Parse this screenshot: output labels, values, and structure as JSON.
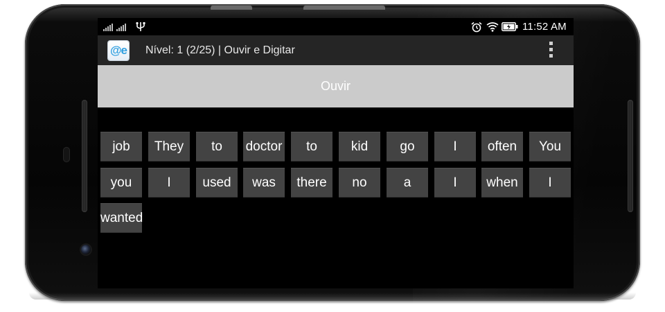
{
  "status_bar": {
    "time": "11:52 AM",
    "icons": [
      "signal-icon",
      "usb-icon",
      "alarm-icon",
      "wifi-icon",
      "battery-icon"
    ]
  },
  "action_bar": {
    "app_icon_text": "@e",
    "title": "Nível: 1 (2/25) | Ouvir e Digitar",
    "menu_icon": "overflow-menu-icon"
  },
  "listen_button": {
    "label": "Ouvir"
  },
  "words": [
    "job",
    "They",
    "to",
    "doctor",
    "to",
    "kid",
    "go",
    "I",
    "often",
    "You",
    "you",
    "I",
    "used",
    "was",
    "there",
    "no",
    "a",
    "I",
    "when",
    "I",
    "wanted"
  ],
  "colors": {
    "screen_background": "#000000",
    "action_bar": "#252525",
    "listen_button": "#cbcbcb",
    "word_button": "#434343",
    "text": "#ffffff"
  }
}
